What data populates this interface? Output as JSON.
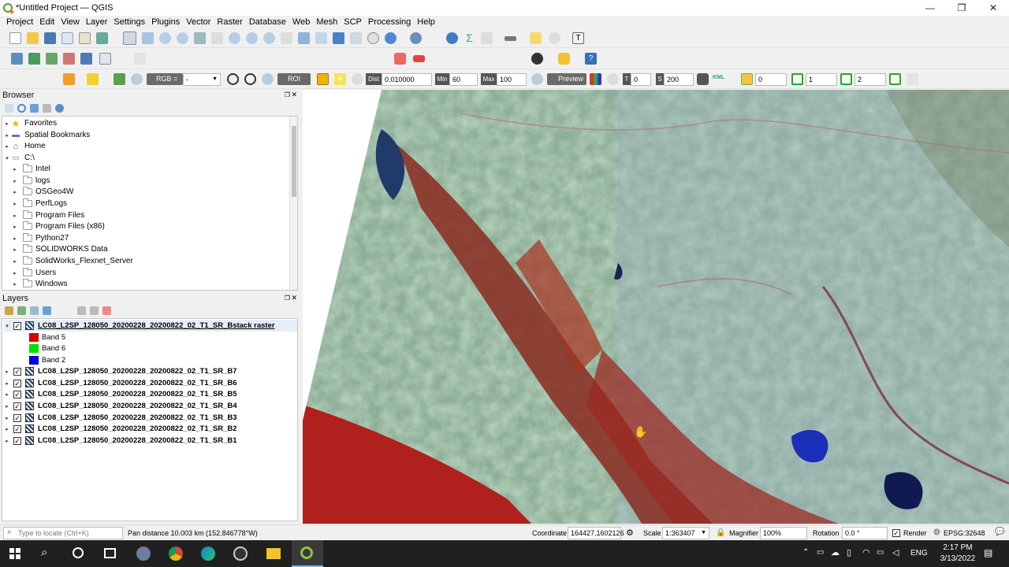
{
  "window": {
    "title": "*Untitled Project — QGIS",
    "controls": [
      "—",
      "❐",
      "✕"
    ]
  },
  "menu": [
    "Project",
    "Edit",
    "View",
    "Layer",
    "Settings",
    "Plugins",
    "Vector",
    "Raster",
    "Database",
    "Web",
    "Mesh",
    "SCP",
    "Processing",
    "Help"
  ],
  "scp_toolbar": {
    "rgb_label": "RGB =",
    "rgb_value": "-",
    "roi_label": "ROI",
    "dist_label": "Dist",
    "dist_value": "0.010000",
    "min_label": "Min",
    "min_value": "60",
    "max_label": "Max",
    "max_value": "100",
    "preview_label": "Preview",
    "t_label": "T",
    "t_value": "0",
    "s_label": "S",
    "s_value": "200",
    "kml_label": "KML",
    "spin1": "0",
    "spin2": "1",
    "spin3": "2"
  },
  "browser": {
    "title": "Browser",
    "items": [
      {
        "label": "Favorites",
        "icon": "star-icon",
        "indent": 0,
        "expand": "▸"
      },
      {
        "label": "Spatial Bookmarks",
        "icon": "bookmark-icon",
        "indent": 0,
        "expand": "▸"
      },
      {
        "label": "Home",
        "icon": "home-icon",
        "indent": 0,
        "expand": "▸"
      },
      {
        "label": "C:\\",
        "icon": "drive-icon",
        "indent": 0,
        "expand": "▾"
      },
      {
        "label": "Intel",
        "icon": "folder-icon",
        "indent": 1,
        "expand": "▸"
      },
      {
        "label": "logs",
        "icon": "folder-icon",
        "indent": 1,
        "expand": "▸"
      },
      {
        "label": "OSGeo4W",
        "icon": "folder-icon",
        "indent": 1,
        "expand": "▸"
      },
      {
        "label": "PerfLogs",
        "icon": "folder-icon",
        "indent": 1,
        "expand": "▸"
      },
      {
        "label": "Program Files",
        "icon": "folder-icon",
        "indent": 1,
        "expand": "▸"
      },
      {
        "label": "Program Files (x86)",
        "icon": "folder-icon",
        "indent": 1,
        "expand": "▸"
      },
      {
        "label": "Python27",
        "icon": "folder-icon",
        "indent": 1,
        "expand": "▸"
      },
      {
        "label": "SOLIDWORKS Data",
        "icon": "folder-icon",
        "indent": 1,
        "expand": "▸"
      },
      {
        "label": "SolidWorks_Flexnet_Server",
        "icon": "folder-icon",
        "indent": 1,
        "expand": "▸"
      },
      {
        "label": "Users",
        "icon": "folder-icon",
        "indent": 1,
        "expand": "▸"
      },
      {
        "label": "Windows",
        "icon": "folder-icon",
        "indent": 1,
        "expand": "▸"
      }
    ]
  },
  "layers": {
    "title": "Layers",
    "group": {
      "label": "LC08_L2SP_128050_20200228_20200822_02_T1_SR_Bstack raster",
      "checked": true
    },
    "bands": [
      {
        "label": "Band 5",
        "color": "#dd0000"
      },
      {
        "label": "Band 6",
        "color": "#00dd00"
      },
      {
        "label": "Band 2",
        "color": "#0000dd"
      }
    ],
    "items": [
      "LC08_L2SP_128050_20200228_20200822_02_T1_SR_B7",
      "LC08_L2SP_128050_20200228_20200822_02_T1_SR_B6",
      "LC08_L2SP_128050_20200228_20200822_02_T1_SR_B5",
      "LC08_L2SP_128050_20200228_20200822_02_T1_SR_B4",
      "LC08_L2SP_128050_20200228_20200822_02_T1_SR_B3",
      "LC08_L2SP_128050_20200228_20200822_02_T1_SR_B2",
      "LC08_L2SP_128050_20200228_20200822_02_T1_SR_B1"
    ]
  },
  "status": {
    "locate_placeholder": "Type to locate (Ctrl+K)",
    "message": "Pan distance 10.003 km (152.846778°W)",
    "coordinate_label": "Coordinate",
    "coordinate_value": "164427,1602126",
    "scale_label": "Scale",
    "scale_value": "1:363407",
    "magnifier_label": "Magnifier",
    "magnifier_value": "100%",
    "rotation_label": "Rotation",
    "rotation_value": "0.0 °",
    "render_label": "Render",
    "crs": "EPSG:32648"
  },
  "taskbar": {
    "lang": "ENG",
    "time": "2:17 PM",
    "date": "3/13/2022"
  },
  "colors": {
    "qgis_green": "#589632",
    "qgis_orange": "#ee7913",
    "taskbar": "#202020"
  }
}
